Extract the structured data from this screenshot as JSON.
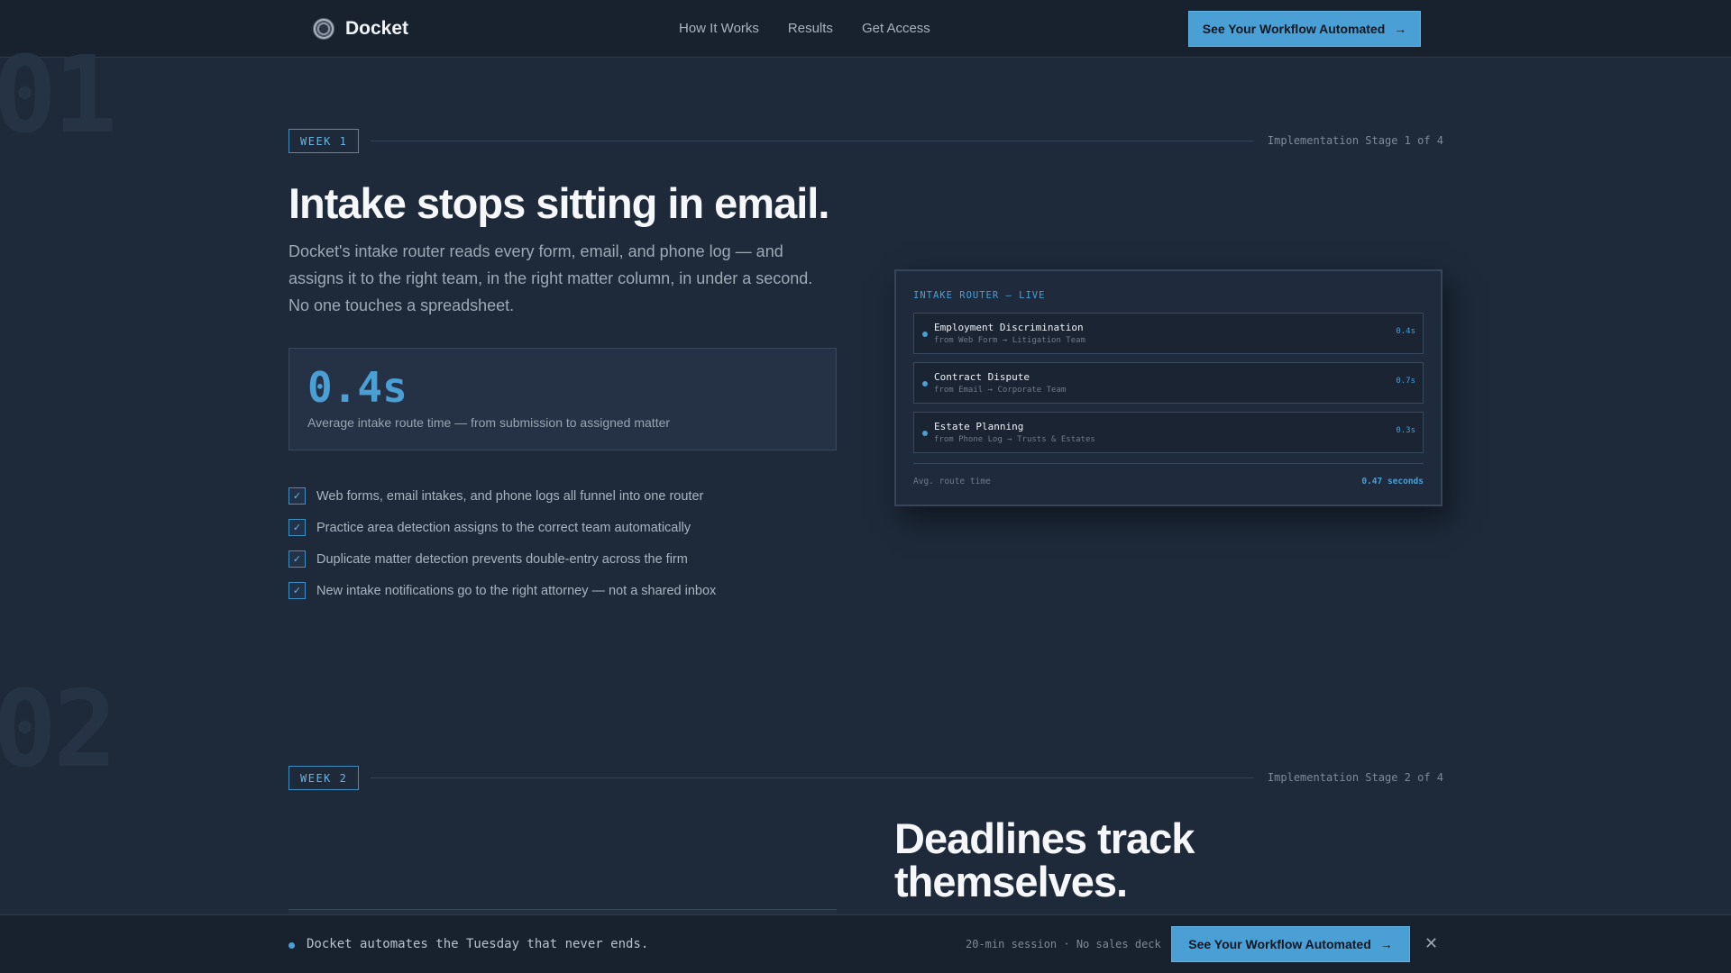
{
  "nav": {
    "brand": "Docket",
    "links": [
      "How It Works",
      "Results",
      "Get Access"
    ],
    "cta": "See Your Workflow Automated",
    "cta_icon": "arrow-right-icon"
  },
  "background_numbers": [
    "01",
    "02"
  ],
  "week1": {
    "badge": "WEEK 1",
    "stage": "Implementation Stage 1 of 4",
    "headline": "Intake stops sitting in email.",
    "lead": "Docket's intake router reads every form, email, and phone log — and assigns it to the right team, in the right matter column, in under a second. No one touches a spreadsheet.",
    "stat": {
      "value": "0.4s",
      "caption": "Average intake route time — from submission to assigned matter"
    },
    "checklist": [
      "Web forms, email intakes, and phone logs all funnel into one router",
      "Practice area detection assigns to the correct team automatically",
      "Duplicate matter detection prevents double-entry across the firm",
      "New intake notifications go to the right attorney — not a shared inbox"
    ],
    "router": {
      "title": "INTAKE ROUTER — LIVE",
      "items": [
        {
          "name": "Employment Discrimination",
          "sub": "from Web Form → Litigation Team",
          "time": "0.4s"
        },
        {
          "name": "Contract Dispute",
          "sub": "from Email → Corporate Team",
          "time": "0.7s"
        },
        {
          "name": "Estate Planning",
          "sub": "from Phone Log → Trusts & Estates",
          "time": "0.3s"
        }
      ],
      "footer_label": "Avg. route time",
      "footer_value": "0.47 seconds"
    }
  },
  "week2": {
    "badge": "WEEK 2",
    "stage": "Implementation Stage 2 of 4",
    "headline": "Deadlines track themselves."
  },
  "bottombar": {
    "text": "Docket automates the Tuesday that never ends.",
    "meta": "20-min session · No sales deck",
    "cta": "See Your Workflow Automated",
    "close_icon": "close-icon"
  },
  "colors": {
    "accent": "#4a9fd5",
    "background": "#1e2a3a",
    "nav_background": "#18212e"
  }
}
